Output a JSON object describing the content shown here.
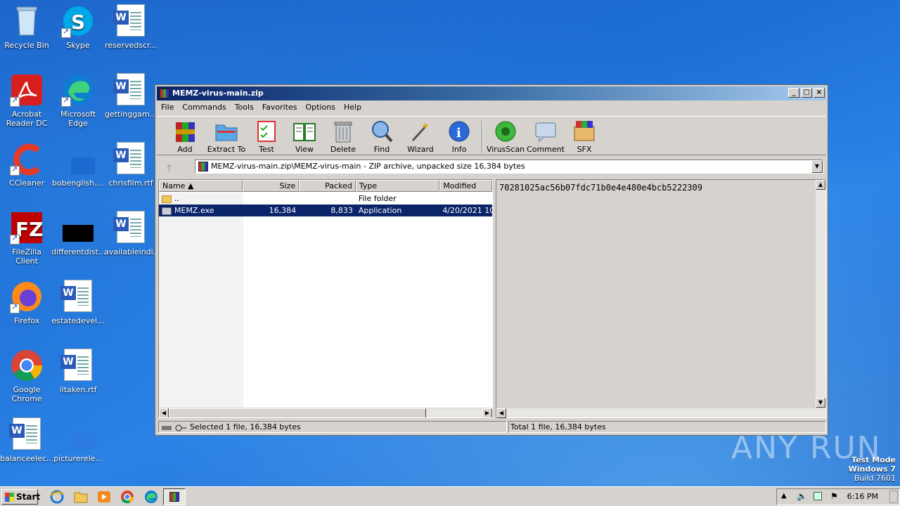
{
  "desktop": {
    "icons": [
      {
        "label": "Recycle Bin"
      },
      {
        "label": "Skype"
      },
      {
        "label": "reservedscr..."
      },
      {
        "label": "Acrobat Reader DC"
      },
      {
        "label": "Microsoft Edge"
      },
      {
        "label": "gettinggam..."
      },
      {
        "label": "CCleaner"
      },
      {
        "label": "bobenglish...."
      },
      {
        "label": "chrisfilm.rtf"
      },
      {
        "label": "FileZilla Client"
      },
      {
        "label": "differentdist..."
      },
      {
        "label": "availableindi..."
      },
      {
        "label": "Firefox"
      },
      {
        "label": "estatedevel..."
      },
      {
        "label": "Google Chrome"
      },
      {
        "label": "iltaken.rtf"
      },
      {
        "label": "balanceelec..."
      },
      {
        "label": "picturerele..."
      }
    ],
    "watermark": "ANY RUN",
    "test_mode": {
      "line1": "Test Mode",
      "line2": "Windows 7",
      "line3": "Build 7601"
    }
  },
  "window": {
    "title": "MEMZ-virus-main.zip",
    "menu": [
      "File",
      "Commands",
      "Tools",
      "Favorites",
      "Options",
      "Help"
    ],
    "toolbar": [
      {
        "label": "Add",
        "icon": "add-icon"
      },
      {
        "label": "Extract To",
        "icon": "extract-to-icon"
      },
      {
        "label": "Test",
        "icon": "test-icon"
      },
      {
        "label": "View",
        "icon": "view-icon"
      },
      {
        "label": "Delete",
        "icon": "delete-icon"
      },
      {
        "label": "Find",
        "icon": "find-icon"
      },
      {
        "label": "Wizard",
        "icon": "wizard-icon"
      },
      {
        "label": "Info",
        "icon": "info-icon"
      },
      {
        "label": "VirusScan",
        "icon": "virusscan-icon"
      },
      {
        "label": "Comment",
        "icon": "comment-icon"
      },
      {
        "label": "SFX",
        "icon": "sfx-icon"
      }
    ],
    "address": "MEMZ-virus-main.zip\\MEMZ-virus-main - ZIP archive, unpacked size 16,384 bytes",
    "columns": [
      "Name",
      "Size",
      "Packed",
      "Type",
      "Modified"
    ],
    "rows": [
      {
        "name": "..",
        "size": "",
        "packed": "",
        "type": "File folder",
        "modified": ""
      },
      {
        "name": "MEMZ.exe",
        "size": "16,384",
        "packed": "8,833",
        "type": "Application",
        "modified": "4/20/2021 10"
      }
    ],
    "comment": "70281025ac56b07fdc71b0e4e480e4bcb5222309",
    "status_left": "Selected 1 file, 16,384 bytes",
    "status_right": "Total 1 file, 16,384 bytes"
  },
  "taskbar": {
    "start_label": "Start",
    "clock": "6:16 PM"
  }
}
